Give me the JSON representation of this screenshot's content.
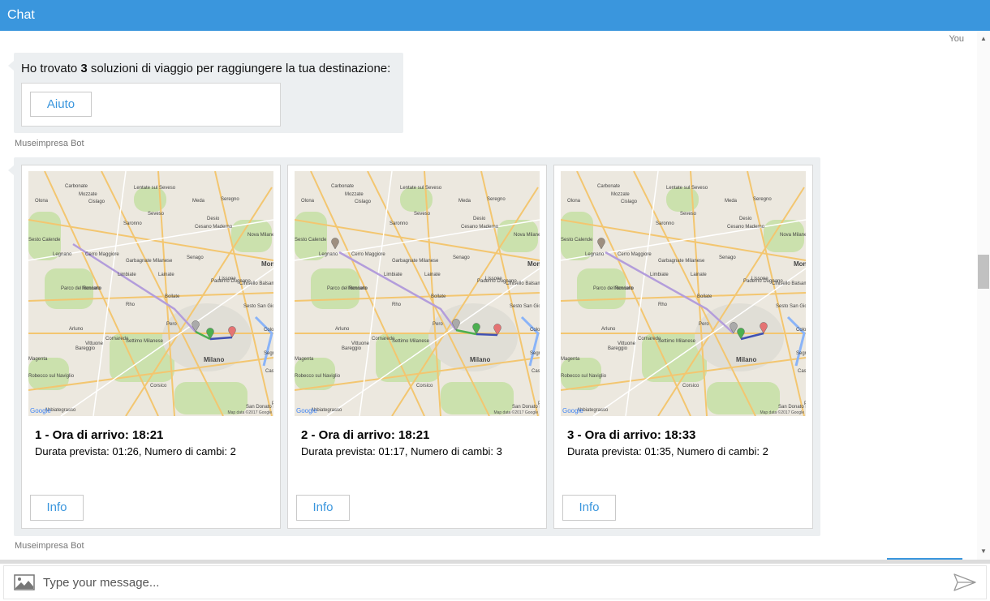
{
  "window": {
    "title": "Chat"
  },
  "history": {
    "you_label": "You",
    "bot_name": "Museimpresa Bot",
    "message1": {
      "prefix": "Ho trovato ",
      "count": "3",
      "suffix": " soluzioni di viaggio per raggiungere la tua destinazione:",
      "button_label": "Aiuto"
    },
    "cards": [
      {
        "title": "1 - Ora di arrivo: 18:21",
        "subtitle": "Durata prevista: 01:26, Numero di cambi: 2",
        "button_label": "Info"
      },
      {
        "title": "2 - Ora di arrivo: 18:21",
        "subtitle": "Durata prevista: 01:17, Numero di cambi: 3",
        "button_label": "Info"
      },
      {
        "title": "3 - Ora di arrivo: 18:33",
        "subtitle": "Durata prevista: 01:35, Numero di cambi: 2",
        "button_label": "Info"
      }
    ]
  },
  "map": {
    "labels": [
      "Carbonate",
      "Mozzate",
      "Lentate sul Seveso",
      "Meda",
      "Seregno",
      "Olona",
      "Cislago",
      "Seveso",
      "Saronno",
      "Cesano Maderno",
      "Desio",
      "Legnano",
      "Cerro Maggiore",
      "Limbiate",
      "Lissone",
      "Parco del Roccolo",
      "Nerviano",
      "Lainate",
      "Paderno Dugnano",
      "Monza",
      "Bollate",
      "Cinisello Balsamo",
      "Rho",
      "Sesto San Giovanni",
      "Pero",
      "Arluno",
      "Cornaredo",
      "Settimo Milanese",
      "Milano",
      "Vittuone",
      "Magenta",
      "Bareggio",
      "Segrate",
      "Robecco sul Naviglio",
      "Corsico",
      "Abbiategrasso",
      "San Donato Milanese",
      "Vermezzo",
      "Zelo Surrigone",
      "Peschiera Borromeo",
      "Nova Milanese",
      "Garbagnate Milanese",
      "Senago",
      "Sesto Calende",
      "Cologno Monzese",
      "Cassina de' Pecchi"
    ],
    "google": "Google",
    "attribution": "Map data ©2017 Google"
  },
  "composer": {
    "placeholder": "Type your message..."
  },
  "colors": {
    "accent": "#3a96dd",
    "bubble": "#eceff1",
    "route_purple": "#b39ddb",
    "route_blue": "#3f51b5",
    "route_green": "#4caf50"
  },
  "icons": {
    "image": "image-icon",
    "send": "send-icon"
  }
}
